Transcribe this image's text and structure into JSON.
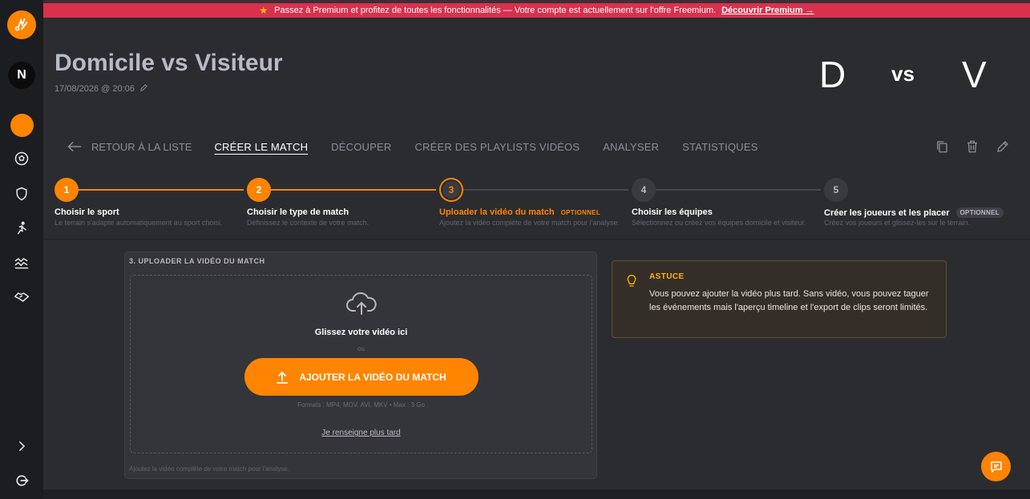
{
  "banner": {
    "message": "Passez à Premium et profitez de toutes les fonctionnalités — Votre compte est actuellement sur l'offre Freemium.",
    "cta": "Découvrir Premium →"
  },
  "sidebar": {
    "avatar_initial": "N"
  },
  "match": {
    "title": "Domicile vs Visiteur",
    "date": "17/08/2026 @ 20:06",
    "home_initial": "D",
    "vs_label": "vs",
    "away_initial": "V"
  },
  "nav": {
    "back_label": "RETOUR À LA LISTE",
    "tabs": [
      {
        "label": "CRÉER LE MATCH",
        "active": true
      },
      {
        "label": "DÉCOUPER"
      },
      {
        "label": "CRÉER DES PLAYLISTS VIDÉOS"
      },
      {
        "label": "ANALYSER"
      },
      {
        "label": "STATISTIQUES"
      }
    ]
  },
  "steps": [
    {
      "number": "1",
      "title": "Choisir le sport",
      "desc": "Le terrain s'adapte automatiquement au sport choisi.",
      "status": "done"
    },
    {
      "number": "2",
      "title": "Choisir le type de match",
      "desc": "Définissez le contexte de votre match.",
      "status": "done"
    },
    {
      "number": "3",
      "title": "Uploader la vidéo du match",
      "badge": "OPTIONNEL",
      "desc": "Ajoutez la vidéo complète de votre match pour l'analyse.",
      "status": "current"
    },
    {
      "number": "4",
      "title": "Choisir les équipes",
      "desc": "Sélectionnez ou créez vos équipes domicile et visiteur.",
      "status": "todo"
    },
    {
      "number": "5",
      "title": "Créer les joueurs et les placer",
      "badge": "OPTIONNEL",
      "desc": "Créez vos joueurs et glissez-les sur le terrain.",
      "status": "todo"
    }
  ],
  "upload": {
    "card_title": "3. UPLOADER LA VIDÉO DU MATCH",
    "drop_text": "Glissez votre vidéo ici",
    "or_text": "ou",
    "button_label": "AJOUTER LA VIDÉO DU MATCH",
    "formats": "Formats : MP4, MOV, AVI, MKV • Max : 3 Go",
    "later_link": "Je renseigne plus tard",
    "footer": "Ajoutez la vidéo complète de votre match pour l'analyse."
  },
  "tip": {
    "title": "ASTUCE",
    "text": "Vous pouvez ajouter la vidéo plus tard. Sans vidéo, vous pouvez taguer les événements mais l'aperçu timeline et l'export de clips seront limités."
  },
  "colors": {
    "accent": "#ff8400",
    "banner": "#d9314d",
    "tip_title": "#ffb300"
  }
}
